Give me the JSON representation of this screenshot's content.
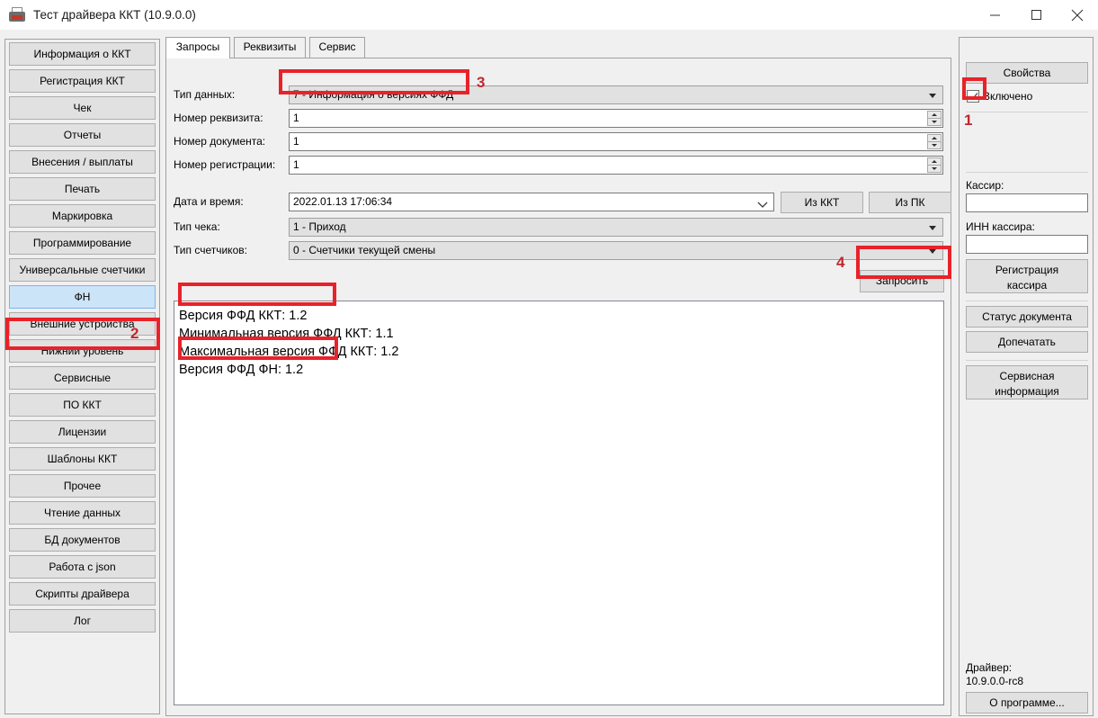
{
  "window": {
    "title": "Тест драйвера ККТ (10.9.0.0)",
    "icon": "printer-icon",
    "minimize": "minimize-icon",
    "maximize": "maximize-icon",
    "close": "close-icon"
  },
  "sidebar": {
    "items": [
      {
        "label": "Информация о ККТ",
        "selected": false
      },
      {
        "label": "Регистрация ККТ",
        "selected": false
      },
      {
        "label": "Чек",
        "selected": false
      },
      {
        "label": "Отчеты",
        "selected": false
      },
      {
        "label": "Внесения / выплаты",
        "selected": false
      },
      {
        "label": "Печать",
        "selected": false
      },
      {
        "label": "Маркировка",
        "selected": false
      },
      {
        "label": "Программирование",
        "selected": false
      },
      {
        "label": "Универсальные счетчики",
        "selected": false
      },
      {
        "label": "ФН",
        "selected": true
      },
      {
        "label": "Внешние устройства",
        "selected": false
      },
      {
        "label": "Нижний уровень",
        "selected": false
      },
      {
        "label": "Сервисные",
        "selected": false
      },
      {
        "label": "ПО ККТ",
        "selected": false
      },
      {
        "label": "Лицензии",
        "selected": false
      },
      {
        "label": "Шаблоны ККТ",
        "selected": false
      },
      {
        "label": "Прочее",
        "selected": false
      },
      {
        "label": "Чтение данных",
        "selected": false
      },
      {
        "label": "БД документов",
        "selected": false
      },
      {
        "label": "Работа с json",
        "selected": false
      },
      {
        "label": "Скрипты драйвера",
        "selected": false
      },
      {
        "label": "Лог",
        "selected": false
      }
    ]
  },
  "main": {
    "tabs": [
      {
        "label": "Запросы",
        "active": true
      },
      {
        "label": "Реквизиты",
        "active": false
      },
      {
        "label": "Сервис",
        "active": false
      }
    ],
    "fields": {
      "data_type_label": "Тип данных:",
      "data_type_value": "7 - Информация о версиях ФФД",
      "req_number_label": "Номер реквизита:",
      "req_number_value": "1",
      "doc_number_label": "Номер документа:",
      "doc_number_value": "1",
      "reg_number_label": "Номер регистрации:",
      "reg_number_value": "1",
      "datetime_label": "Дата и время:",
      "datetime_value": "2022.01.13 17:06:34",
      "receipt_type_label": "Тип чека:",
      "receipt_type_value": "1 - Приход",
      "counters_type_label": "Тип счетчиков:",
      "counters_type_value": "0 - Счетчики текущей смены"
    },
    "buttons": {
      "from_kkt": "Из ККТ",
      "from_pc": "Из ПК",
      "request": "Запросить"
    },
    "result_lines": [
      {
        "text": "Версия ФФД ККТ: 1.2",
        "highlighted": true
      },
      {
        "text": "Минимальная версия ФФД ККТ: 1.1",
        "highlighted": false
      },
      {
        "text": "Максимальная версия ФФД ККТ: 1.2",
        "highlighted": false
      },
      {
        "text": "Версия ФФД ФН: 1.2",
        "highlighted": true
      }
    ]
  },
  "right_panel": {
    "properties_button": "Свойства",
    "enabled_checkbox_label": "Включено",
    "enabled_checked": true,
    "cashier_label": "Кассир:",
    "cashier_value": "",
    "cashier_inn_label": "ИНН кассира:",
    "cashier_inn_value": "",
    "register_cashier_button": "Регистрация\nкассира",
    "doc_status_button": "Статус документа",
    "reprint_button": "Допечатать",
    "service_info_button": "Сервисная\nинформация",
    "driver_label": "Драйвер:",
    "driver_version": "10.9.0.0-rc8",
    "about_button": "О программе..."
  },
  "annotations": {
    "markers": [
      {
        "number": "1",
        "target": "enabled-checkbox"
      },
      {
        "number": "2",
        "target": "sidebar-item-fn"
      },
      {
        "number": "3",
        "target": "data-type-combo"
      },
      {
        "number": "4",
        "target": "request-button"
      }
    ],
    "accent_color": "#e8222a",
    "number_color": "#c0272d"
  }
}
